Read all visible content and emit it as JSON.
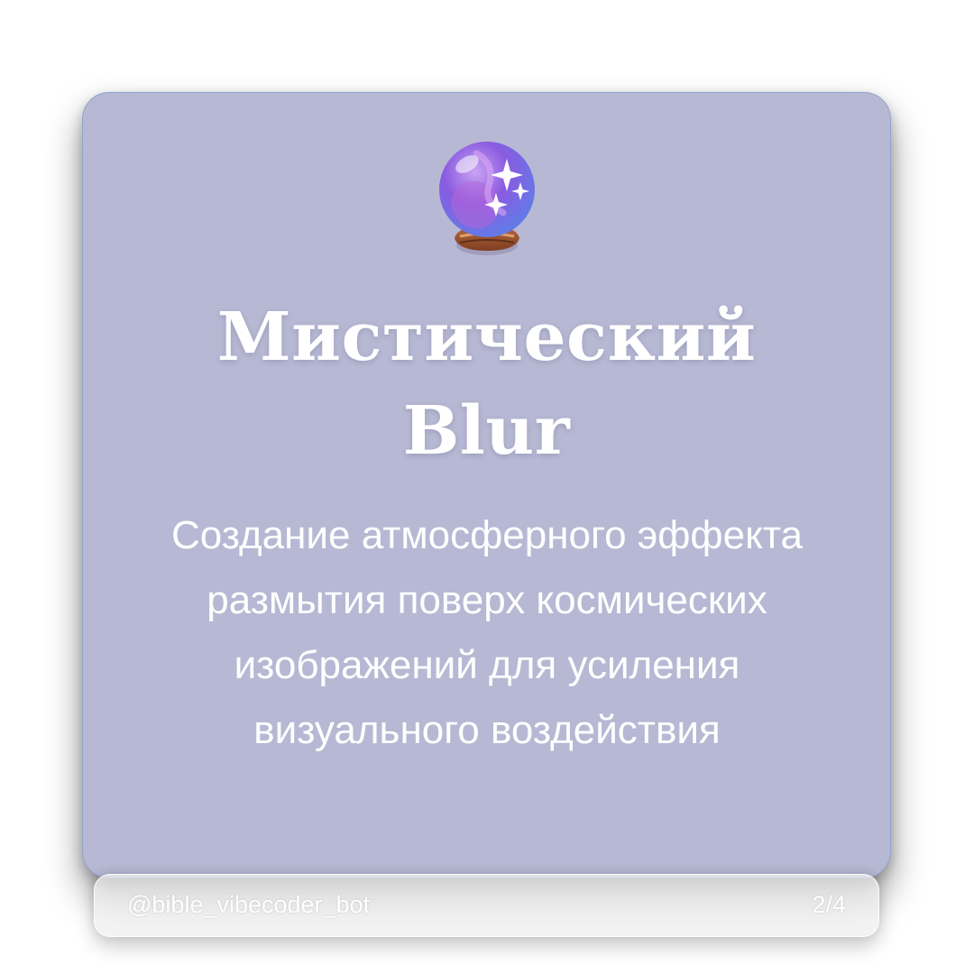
{
  "card": {
    "icon": "crystal-ball-icon",
    "title_line1": "Мистический",
    "title_line2": "Blur",
    "subtitle": "Создание атмосферного эффекта размытия поверх космических изображений для усиления визуального воздействия"
  },
  "footer": {
    "handle": "@bible_vibecoder_bot",
    "page_indicator": "2/4"
  },
  "colors": {
    "card_background": "#b7b8d3",
    "card_border": "#8fa6cf",
    "text": "#ffffff",
    "page_background": "#ffffff"
  }
}
